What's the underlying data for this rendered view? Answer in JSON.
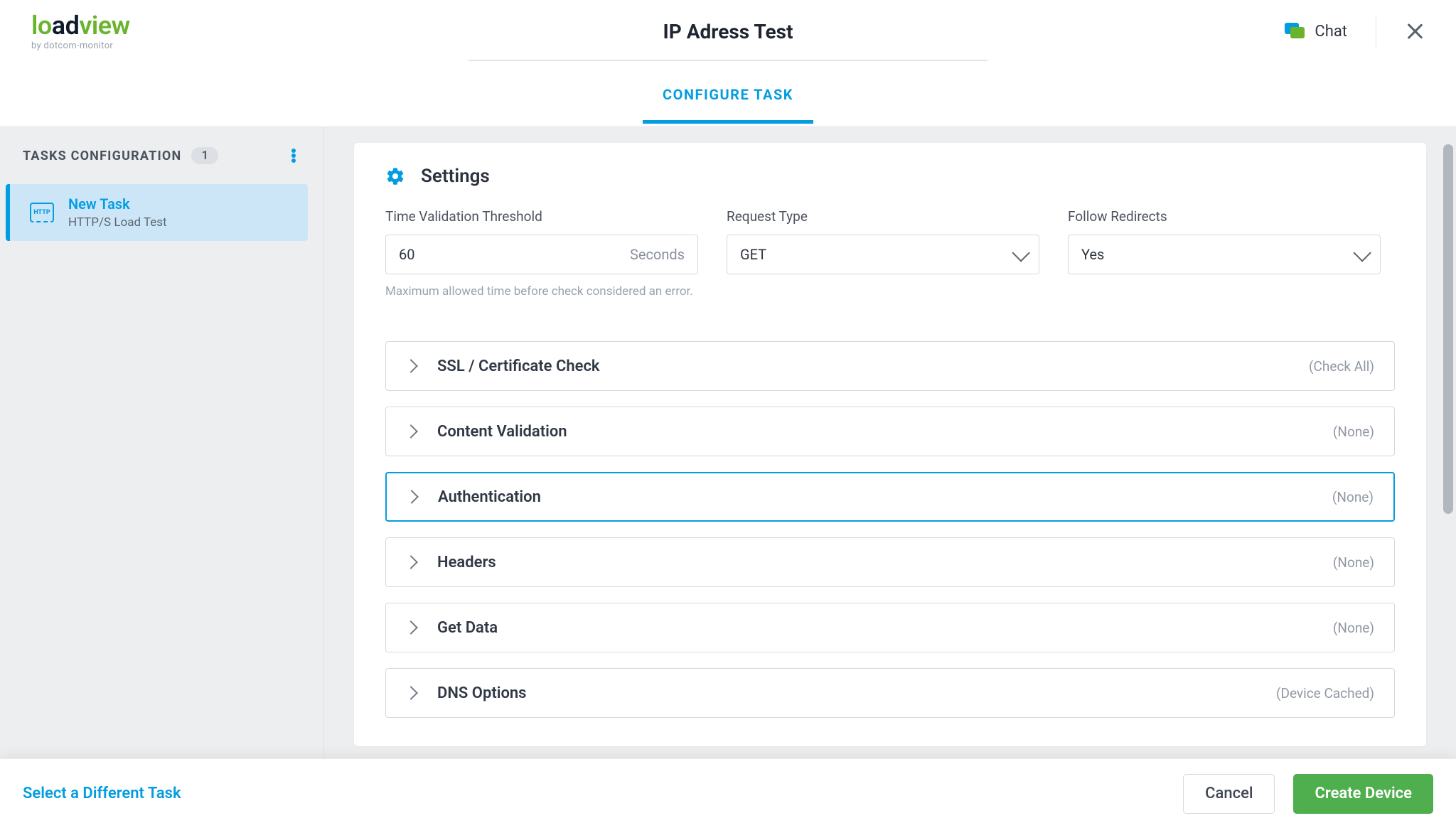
{
  "header": {
    "logo": {
      "part1": "lo",
      "part2": "ad",
      "part3": "view",
      "sub": "by dotcom-monitor"
    },
    "title": "IP Adress Test",
    "chat_label": "Chat"
  },
  "tabs": {
    "configure": "CONFIGURE TASK"
  },
  "sidebar": {
    "title": "TASKS CONFIGURATION",
    "count": "1",
    "task": {
      "name": "New Task",
      "type": "HTTP/S Load Test",
      "icon_label": "HTTP"
    }
  },
  "settings": {
    "title": "Settings",
    "time_threshold": {
      "label": "Time Validation Threshold",
      "value": "60",
      "unit": "Seconds",
      "hint": "Maximum allowed time before check considered an error."
    },
    "request_type": {
      "label": "Request Type",
      "value": "GET"
    },
    "follow_redirects": {
      "label": "Follow Redirects",
      "value": "Yes"
    }
  },
  "accordions": [
    {
      "title": "SSL / Certificate Check",
      "meta": "(Check All)",
      "active": false
    },
    {
      "title": "Content Validation",
      "meta": "(None)",
      "active": false
    },
    {
      "title": "Authentication",
      "meta": "(None)",
      "active": true
    },
    {
      "title": "Headers",
      "meta": "(None)",
      "active": false
    },
    {
      "title": "Get Data",
      "meta": "(None)",
      "active": false
    },
    {
      "title": "DNS Options",
      "meta": "(Device Cached)",
      "active": false
    }
  ],
  "footer": {
    "link": "Select a Different Task",
    "cancel": "Cancel",
    "primary": "Create Device"
  }
}
